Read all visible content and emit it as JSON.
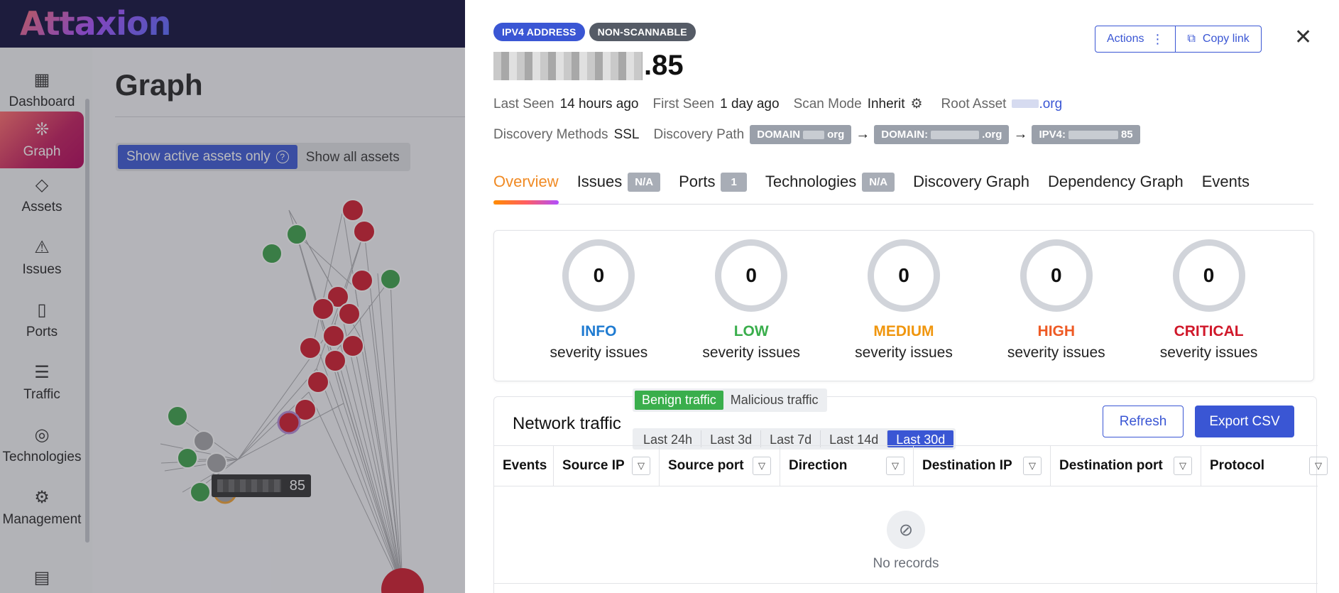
{
  "app": {
    "logo": "Attaxion",
    "page_title": "Graph",
    "nav": [
      {
        "label": "Dashboard",
        "icon": "dashboard-icon"
      },
      {
        "label": "Graph",
        "icon": "graph-icon",
        "active": true
      },
      {
        "label": "Assets",
        "icon": "layers-icon"
      },
      {
        "label": "Issues",
        "icon": "warning-icon"
      },
      {
        "label": "Ports",
        "icon": "port-icon"
      },
      {
        "label": "Traffic",
        "icon": "traffic-icon"
      },
      {
        "label": "Technologies",
        "icon": "fingerprint-icon"
      },
      {
        "label": "Management",
        "icon": "gear-icon"
      }
    ],
    "filter": {
      "active_label": "Show active assets only",
      "all_label": "Show all assets"
    },
    "graph_node_label": "85"
  },
  "drawer": {
    "badges": [
      "IPV4 ADDRESS",
      "NON-SCANNABLE"
    ],
    "title_suffix": ".85",
    "actions_label": "Actions",
    "copy_link_label": "Copy link",
    "meta": {
      "last_seen_label": "Last Seen",
      "last_seen": "14 hours ago",
      "first_seen_label": "First Seen",
      "first_seen": "1 day ago",
      "scan_mode_label": "Scan Mode",
      "scan_mode": "Inherit",
      "root_asset_label": "Root Asset",
      "root_asset": ".org",
      "discovery_methods_label": "Discovery Methods",
      "discovery_methods": "SSL",
      "discovery_path_label": "Discovery Path",
      "path": [
        "DOMAIN",
        "org",
        "DOMAIN:",
        ".org",
        "IPV4:",
        "85"
      ]
    },
    "tabs": [
      {
        "label": "Overview",
        "active": true
      },
      {
        "label": "Issues",
        "count": "N/A"
      },
      {
        "label": "Ports",
        "count": "1"
      },
      {
        "label": "Technologies",
        "count": "N/A"
      },
      {
        "label": "Discovery Graph"
      },
      {
        "label": "Dependency Graph"
      },
      {
        "label": "Events"
      }
    ],
    "severity": [
      {
        "count": "0",
        "name": "INFO",
        "color": "#1f7bd1"
      },
      {
        "count": "0",
        "name": "LOW",
        "color": "#3aae4c"
      },
      {
        "count": "0",
        "name": "MEDIUM",
        "color": "#f0960e"
      },
      {
        "count": "0",
        "name": "HIGH",
        "color": "#ee5a24"
      },
      {
        "count": "0",
        "name": "CRITICAL",
        "color": "#d0182a"
      }
    ],
    "severity_sub": "severity issues",
    "traffic": {
      "title": "Network traffic",
      "mode": [
        "Benign traffic",
        "Malicious traffic"
      ],
      "ranges": [
        "Last 24h",
        "Last 3d",
        "Last 7d",
        "Last 14d",
        "Last 30d"
      ],
      "refresh": "Refresh",
      "export": "Export CSV",
      "columns": [
        "Events",
        "Source IP",
        "Source port",
        "Direction",
        "Destination IP",
        "Destination port",
        "Protocol"
      ],
      "empty": "No records"
    }
  }
}
